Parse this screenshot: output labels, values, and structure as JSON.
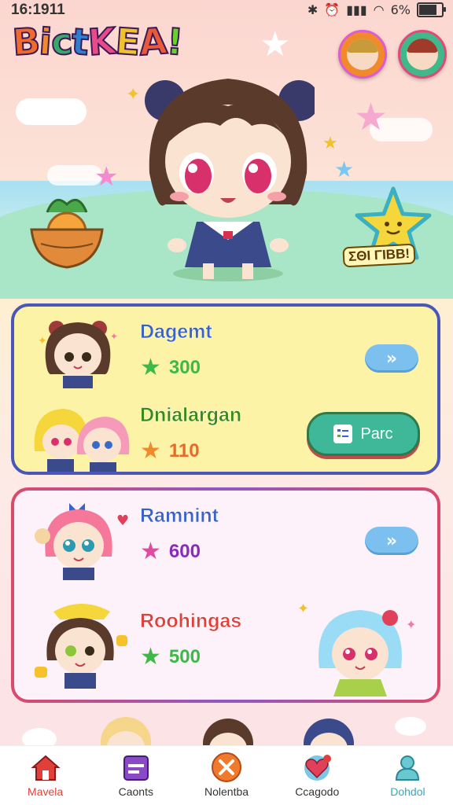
{
  "status_bar": {
    "time": "16:1911",
    "battery": "6%"
  },
  "app": {
    "logo": [
      "B",
      "i",
      "c",
      "t",
      "K",
      "E",
      "A",
      "!"
    ],
    "logo_colors": [
      "#f06a2b",
      "#f08a2b",
      "#39a86a",
      "#2f7fd0",
      "#e84a8a",
      "#f0c22b",
      "#e85a3b",
      "#6ad02b"
    ]
  },
  "header": {
    "avatar_left": "profile-avatar",
    "avatar_right": "friend-avatar"
  },
  "hero": {
    "badge": "ΣΘΙ ΓΙΒΒ!"
  },
  "card_blue": {
    "rows": [
      {
        "name": "Dagemt",
        "name_color": "#3a63c8",
        "score": "300",
        "star_color": "#3fb84a",
        "score_color": "#3fb84a",
        "action": "»"
      },
      {
        "name": "Dnialargan",
        "name_color": "#3a8a1a",
        "score": "110",
        "star_color": "#f08a2b",
        "score_color": "#e86a2b",
        "action": "Parc"
      }
    ]
  },
  "card_red": {
    "rows": [
      {
        "name": "Ramnint",
        "name_color": "#3a63c8",
        "score": "600",
        "star_color": "#e04aa0",
        "score_color": "#8a2ab8",
        "action": "»"
      },
      {
        "name": "Roohingas",
        "name_color": "#e0403a",
        "score": "500",
        "star_color": "#3fb84a",
        "score_color": "#3fb84a"
      }
    ]
  },
  "tabs": [
    {
      "label": "Mavela",
      "icon": "home-icon",
      "color": "#e0403a",
      "active": true
    },
    {
      "label": "Caonts",
      "icon": "calendar-icon",
      "color": "#8a4ac8"
    },
    {
      "label": "Nolentba",
      "icon": "close-icon",
      "color": "#f07a2b"
    },
    {
      "label": "Ccagodo",
      "icon": "heart-icon",
      "color": "#e0405a"
    },
    {
      "label": "Dohdol",
      "icon": "person-icon",
      "color": "#3aa8b8"
    }
  ]
}
